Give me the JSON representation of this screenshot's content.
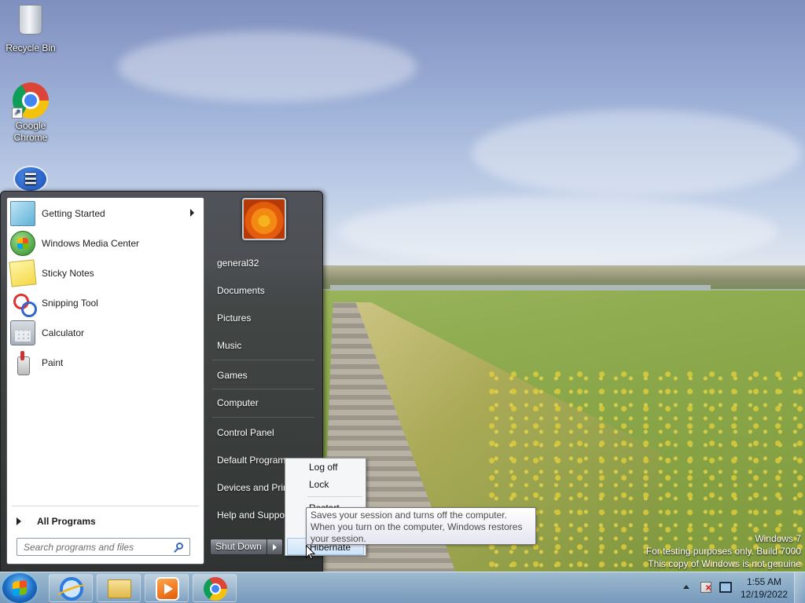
{
  "desktop": {
    "icons": [
      {
        "label": "Recycle Bin",
        "icon": "recycle-bin-icon"
      },
      {
        "label": "Google Chrome",
        "icon": "chrome-icon"
      },
      {
        "label": "",
        "icon": "app-icon"
      }
    ],
    "watermark": {
      "line1": "Windows 7",
      "line2": "For testing purposes only. Build 7000",
      "line3": "This copy of Windows is not genuine"
    }
  },
  "start_menu": {
    "programs": [
      {
        "label": "Getting Started",
        "icon": "getting-started-icon",
        "has_submenu": true
      },
      {
        "label": "Windows Media Center",
        "icon": "media-center-icon"
      },
      {
        "label": "Sticky Notes",
        "icon": "sticky-notes-icon"
      },
      {
        "label": "Snipping Tool",
        "icon": "snipping-tool-icon"
      },
      {
        "label": "Calculator",
        "icon": "calculator-icon"
      },
      {
        "label": "Paint",
        "icon": "paint-icon"
      }
    ],
    "all_programs": "All Programs",
    "search_placeholder": "Search programs and files",
    "right_items": [
      "general32",
      "Documents",
      "Pictures",
      "Music",
      "Games",
      "Computer",
      "Control Panel",
      "Default Programs",
      "Devices and Printers",
      "Help and Support"
    ],
    "shutdown_label": "Shut Down",
    "power_menu": [
      "Log off",
      "Lock",
      "Restart",
      "Hibernate"
    ],
    "tooltip": "Saves your session and turns off the computer. When you turn on the computer, Windows restores your session."
  },
  "taskbar": {
    "pinned": [
      {
        "name": "internet-explorer",
        "icon": "ie-icon"
      },
      {
        "name": "windows-explorer",
        "icon": "folder-icon"
      },
      {
        "name": "windows-media-player",
        "icon": "media-player-icon"
      },
      {
        "name": "google-chrome",
        "icon": "chrome-icon"
      }
    ],
    "clock": {
      "time": "1:55 AM",
      "date": "12/19/2022"
    }
  }
}
